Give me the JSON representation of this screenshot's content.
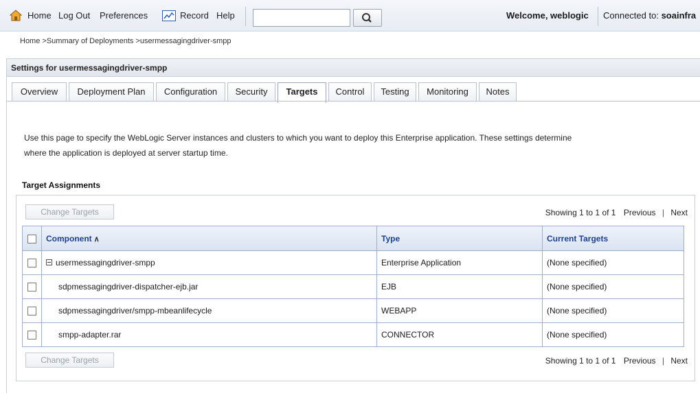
{
  "toolbar": {
    "home_label": "Home",
    "logout_label": "Log Out",
    "preferences_label": "Preferences",
    "record_label": "Record",
    "help_label": "Help",
    "search_value": "",
    "welcome_text": "Welcome, weblogic",
    "connected_label": "Connected to: ",
    "connected_domain": "soainfra"
  },
  "breadcrumb": {
    "items": [
      "Home",
      "Summary of Deployments"
    ],
    "current": "usermessagingdriver-smpp",
    "separator": " >"
  },
  "panel": {
    "title": "Settings for usermessagingdriver-smpp"
  },
  "tabs": [
    {
      "label": "Overview"
    },
    {
      "label": "Deployment Plan"
    },
    {
      "label": "Configuration"
    },
    {
      "label": "Security"
    },
    {
      "label": "Targets",
      "active": true
    },
    {
      "label": "Control"
    },
    {
      "label": "Testing"
    },
    {
      "label": "Monitoring"
    },
    {
      "label": "Notes"
    }
  ],
  "description": {
    "line1": "Use this page to specify the WebLogic Server instances and clusters to which you want to deploy this Enterprise application. These settings determine",
    "line2": "where the application is deployed at server startup time."
  },
  "target_assignments": {
    "heading": "Target Assignments",
    "change_targets_label": "Change Targets",
    "paging": {
      "showing": "Showing 1 to 1 of 1",
      "previous": "Previous",
      "separator": "|",
      "next": "Next"
    },
    "columns": {
      "component": "Component",
      "type": "Type",
      "current_targets": "Current Targets"
    },
    "rows": [
      {
        "component": "usermessagingdriver-smpp",
        "type": "Enterprise Application",
        "targets": "(None specified)"
      },
      {
        "component": "sdpmessagingdriver-dispatcher-ejb.jar",
        "type": "EJB",
        "targets": "(None specified)"
      },
      {
        "component": "sdpmessagingdriver/smpp-mbeanlifecycle",
        "type": "WEBAPP",
        "targets": "(None specified)"
      },
      {
        "component": "smpp-adapter.rar",
        "type": "CONNECTOR",
        "targets": "(None specified)"
      }
    ]
  },
  "colors": {
    "header_link": "#1f3f8f",
    "table_border": "#9fb0c6",
    "disabled_text": "#9aa2ad"
  }
}
